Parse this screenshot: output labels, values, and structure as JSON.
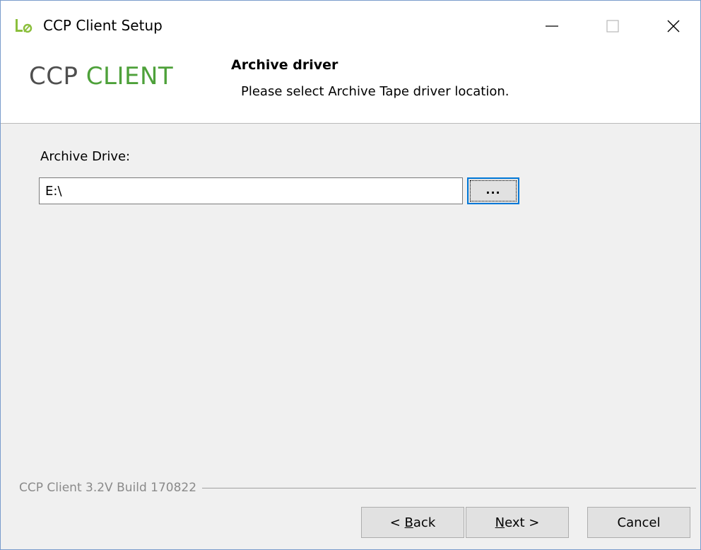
{
  "window": {
    "title": "CCP Client Setup",
    "icons": {
      "app": "app-logo-icon",
      "minimize": "minimize-icon",
      "maximize": "maximize-icon",
      "close": "close-icon"
    }
  },
  "header": {
    "logo_primary": "CCP",
    "logo_accent": "CLIENT",
    "title": "Archive driver",
    "subtitle": "Please select Archive Tape driver location."
  },
  "form": {
    "label": "Archive Drive:",
    "value": "E:\\",
    "browse_label": "..."
  },
  "footer": {
    "version": "CCP Client 3.2V Build 170822",
    "back": {
      "prefix": "< ",
      "mnemonic": "B",
      "rest": "ack"
    },
    "next": {
      "mnemonic": "N",
      "rest": "ext >"
    },
    "cancel": "Cancel"
  },
  "colors": {
    "accent": "#0078d7",
    "logo_green": "#4ea13a",
    "logo_gray": "#4f4f4f"
  }
}
